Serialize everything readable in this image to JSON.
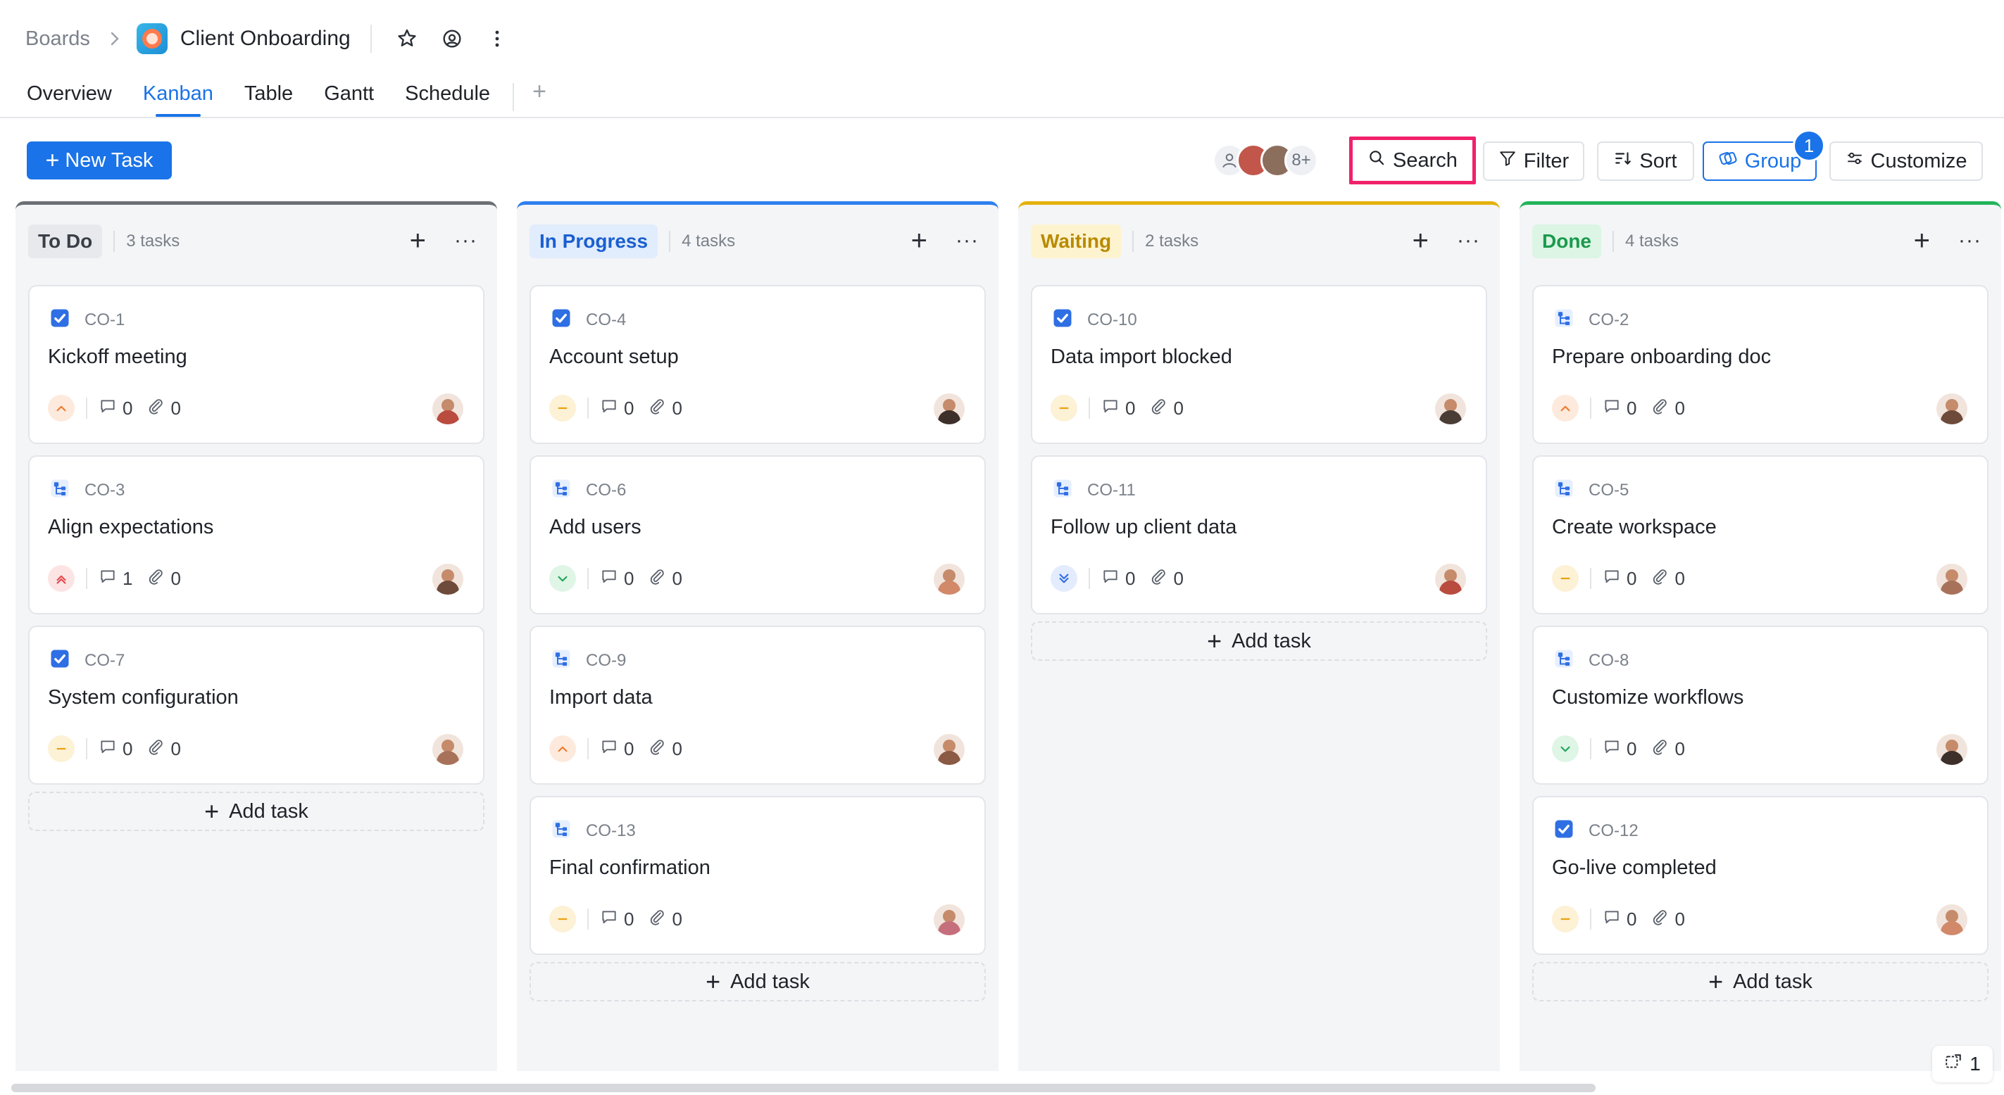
{
  "header": {
    "breadcrumb_root": "Boards",
    "board_title": "Client Onboarding"
  },
  "tabs": [
    {
      "label": "Overview",
      "active": false
    },
    {
      "label": "Kanban",
      "active": true
    },
    {
      "label": "Table",
      "active": false
    },
    {
      "label": "Gantt",
      "active": false
    },
    {
      "label": "Schedule",
      "active": false
    }
  ],
  "toolbar": {
    "new_task_label": "New Task",
    "members_overflow": "8+",
    "search_label": "Search",
    "filter_label": "Filter",
    "sort_label": "Sort",
    "group_label": "Group",
    "group_badge": "1",
    "customize_label": "Customize"
  },
  "colors": {
    "accent": "#1a73e8",
    "highlight": "#f0216b"
  },
  "columns": [
    {
      "name": "To Do",
      "count_label": "3 tasks",
      "accent": "#6b6f76",
      "pill_bg": "#e8e9ec",
      "pill_fg": "#3a3f47",
      "add_label": "Add task",
      "cards": [
        {
          "id": "CO-1",
          "title": "Kickoff meeting",
          "type": "task",
          "priority": "high",
          "comments": "0",
          "attachments": "0"
        },
        {
          "id": "CO-3",
          "title": "Align expectations",
          "type": "subtask",
          "priority": "urgent",
          "comments": "1",
          "attachments": "0"
        },
        {
          "id": "CO-7",
          "title": "System configuration",
          "type": "task",
          "priority": "medium",
          "comments": "0",
          "attachments": "0"
        }
      ]
    },
    {
      "name": "In Progress",
      "count_label": "4 tasks",
      "accent": "#2f7ff0",
      "pill_bg": "#e1ecfc",
      "pill_fg": "#1a5fd0",
      "add_label": "Add task",
      "cards": [
        {
          "id": "CO-4",
          "title": "Account setup",
          "type": "task",
          "priority": "medium",
          "comments": "0",
          "attachments": "0"
        },
        {
          "id": "CO-6",
          "title": "Add users",
          "type": "subtask",
          "priority": "low",
          "comments": "0",
          "attachments": "0"
        },
        {
          "id": "CO-9",
          "title": "Import data",
          "type": "subtask",
          "priority": "high",
          "comments": "0",
          "attachments": "0"
        },
        {
          "id": "CO-13",
          "title": "Final confirmation",
          "type": "subtask",
          "priority": "medium",
          "comments": "0",
          "attachments": "0"
        }
      ]
    },
    {
      "name": "Waiting",
      "count_label": "2 tasks",
      "accent": "#e4b10d",
      "pill_bg": "#fdf3cf",
      "pill_fg": "#b98a00",
      "add_label": "Add task",
      "cards": [
        {
          "id": "CO-10",
          "title": "Data import blocked",
          "type": "task",
          "priority": "medium",
          "comments": "0",
          "attachments": "0"
        },
        {
          "id": "CO-11",
          "title": "Follow up client data",
          "type": "subtask",
          "priority": "lowest",
          "comments": "0",
          "attachments": "0"
        }
      ]
    },
    {
      "name": "Done",
      "count_label": "4 tasks",
      "accent": "#22b45a",
      "pill_bg": "#dcf5e5",
      "pill_fg": "#1b9a4c",
      "add_label": "Add task",
      "cards": [
        {
          "id": "CO-2",
          "title": "Prepare onboarding doc",
          "type": "subtask",
          "priority": "high",
          "comments": "0",
          "attachments": "0"
        },
        {
          "id": "CO-5",
          "title": "Create workspace",
          "type": "subtask",
          "priority": "medium",
          "comments": "0",
          "attachments": "0"
        },
        {
          "id": "CO-8",
          "title": "Customize workflows",
          "type": "subtask",
          "priority": "low",
          "comments": "0",
          "attachments": "0"
        },
        {
          "id": "CO-12",
          "title": "Go-live completed",
          "type": "task",
          "priority": "medium",
          "comments": "0",
          "attachments": "0"
        }
      ]
    }
  ],
  "footer": {
    "selection_count": "1"
  }
}
